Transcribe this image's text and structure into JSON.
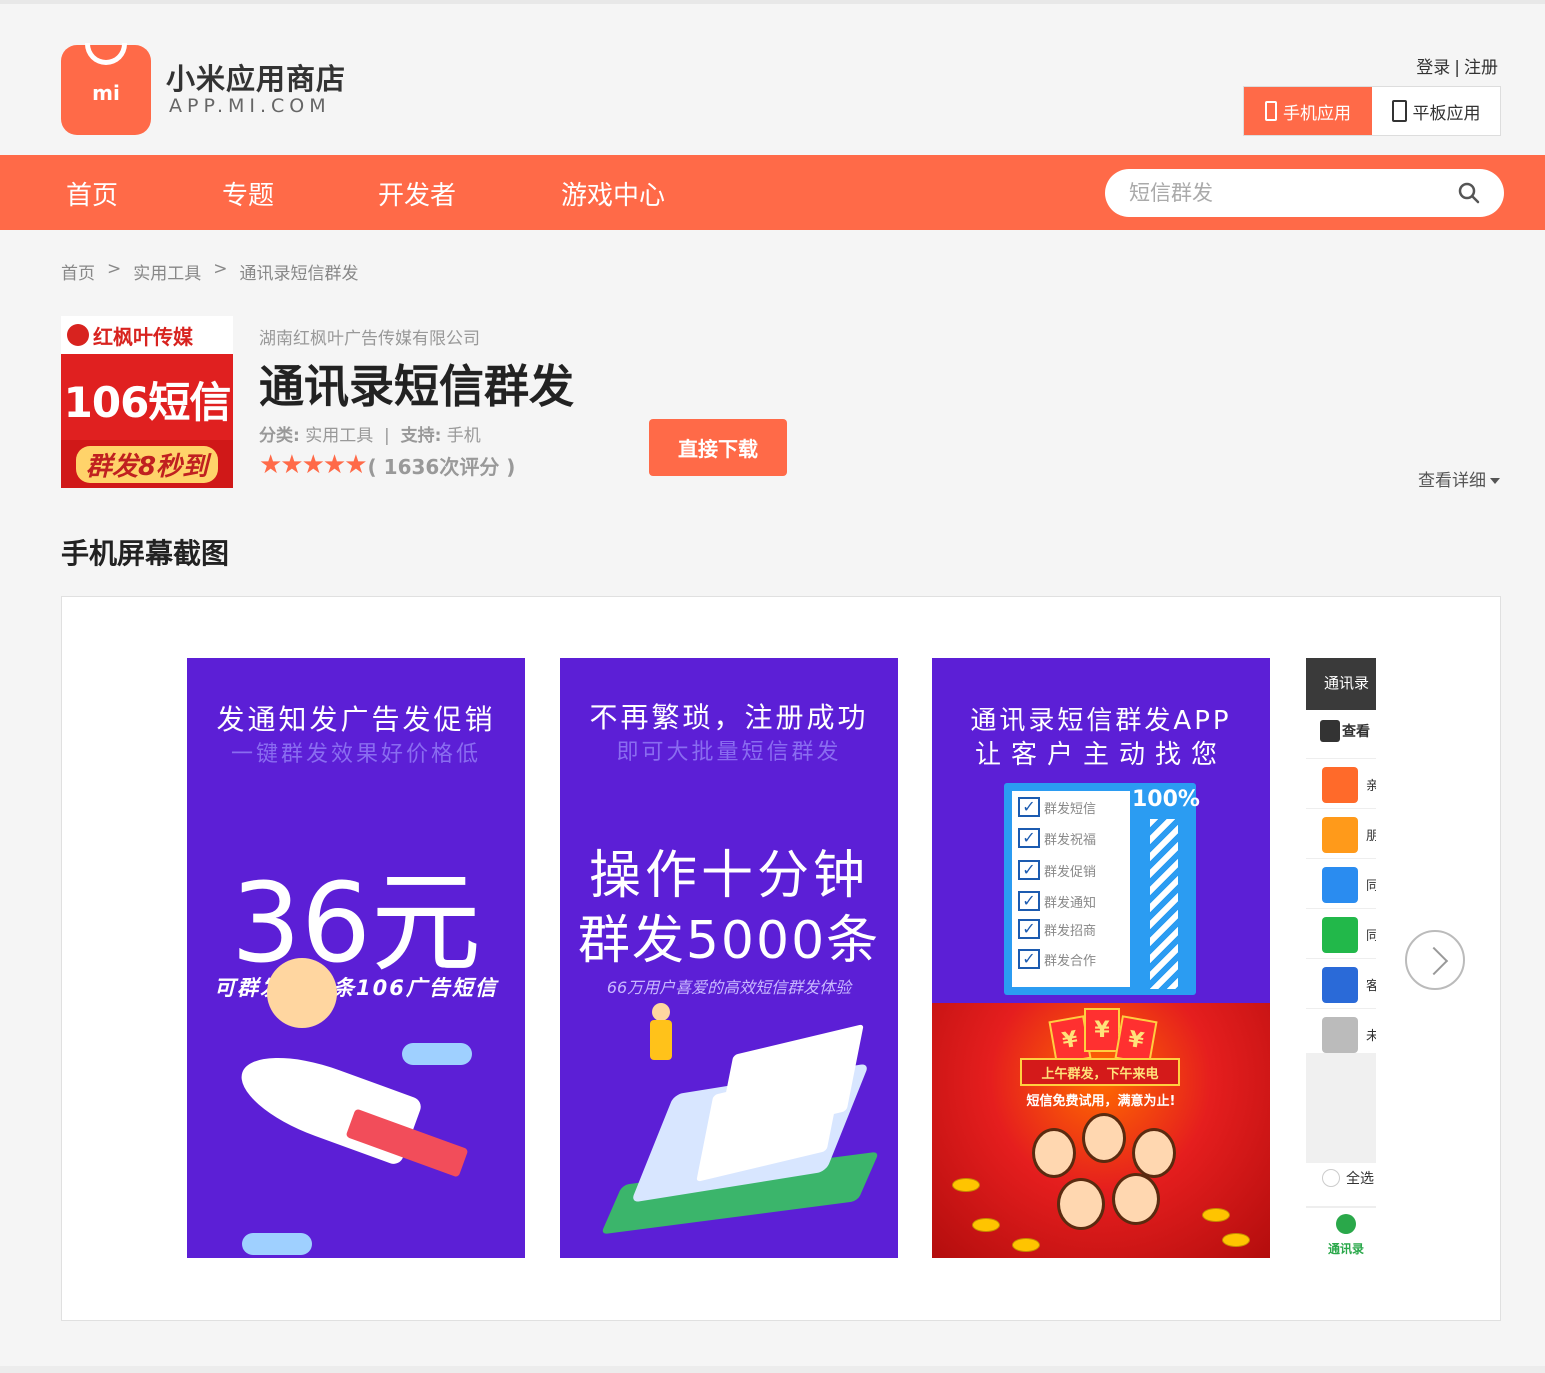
{
  "header": {
    "brand_name": "小米应用商店",
    "brand_domain": "APP.MI.COM",
    "logo_text": "mi",
    "login": "登录",
    "register": "注册",
    "device_tabs": [
      "手机应用",
      "平板应用"
    ],
    "active_device": "手机应用"
  },
  "nav": {
    "items": [
      "首页",
      "专题",
      "开发者",
      "游戏中心"
    ],
    "search_placeholder": "短信群发"
  },
  "breadcrumb": [
    "首页",
    "实用工具",
    "通讯录短信群发"
  ],
  "app": {
    "publisher": "湖南红枫叶广告传媒有限公司",
    "title": "通讯录短信群发",
    "category_label": "分类:",
    "category": "实用工具",
    "support_label": "支持:",
    "support": "手机",
    "stars": 5,
    "rating_count": "( 1636次评分 )",
    "download_label": "直接下载",
    "details_label": "查看详细",
    "icon_brand": "红枫叶传媒",
    "icon_main": "106短信",
    "icon_slogan": "群发8秒到"
  },
  "screenshots": {
    "section_title": "手机屏幕截图",
    "shot1": {
      "h1": "发通知发广告发促销",
      "h2": "一键群发效果好价格低",
      "big": "36元",
      "note": "可群发500条106广告短信"
    },
    "shot2": {
      "h1": "不再繁琐，注册成功",
      "h2": "即可大批量短信群发",
      "big1": "操作十分钟",
      "big2": "群发5000条",
      "note": "66万用户喜爱的高效短信群发体验"
    },
    "shot3": {
      "h1": "通讯录短信群发APP",
      "h2": "让客户主动找您",
      "checklist": [
        "群发短信",
        "群发祝福",
        "群发促销",
        "群发通知",
        "群发招商",
        "群发合作"
      ],
      "percent": "100%",
      "envelope_symbol": "¥",
      "banner": "上午群发，下午来电",
      "sub": "短信免费试用，满意为止!"
    },
    "shot4": {
      "header": "通讯录",
      "view": "查看",
      "rows": [
        "亲",
        "朋",
        "同",
        "同",
        "客",
        "未"
      ],
      "row_colors": [
        "#ff6a2a",
        "#ff9a1a",
        "#2a8cf0",
        "#22b84a",
        "#2a6ad8",
        "#bbbbbb"
      ],
      "select_all": "全选",
      "contacts": "通讯录"
    }
  },
  "colors": {
    "accent": "#ff6a48",
    "shot_bg": "#5c1fd6"
  }
}
